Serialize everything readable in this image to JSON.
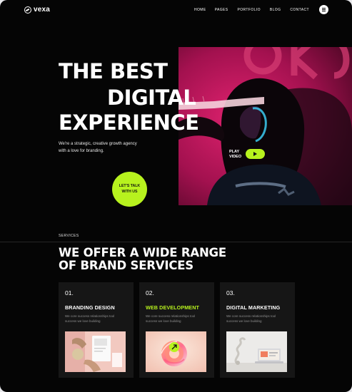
{
  "header": {
    "logo": "vexa",
    "nav": [
      "HOME",
      "PAGES",
      "PORTFOLIO",
      "BLOG",
      "CONTACT"
    ]
  },
  "hero": {
    "line1": "THE BEST",
    "line2": "DIGITAL",
    "line3": "EXPERIENCE",
    "subtitle": "We're a strategic, creative growth agency with a love for branding.",
    "cta": "LET'S TALK WITH US",
    "play_line1": "PLAY",
    "play_line2": "VIDEO"
  },
  "services": {
    "eyebrow": "SERVICES",
    "title_line1": "WE OFFER A WIDE RANGE",
    "title_line2": "OF BRAND SERVICES",
    "cards": [
      {
        "num": "01.",
        "title": "BRANDING DESIGN",
        "desc": "We core success relationships tool success we love building"
      },
      {
        "num": "02.",
        "title": "WEB DEVELOPMENT",
        "desc": "We core success relationships tool success we love building"
      },
      {
        "num": "03.",
        "title": "DIGITAL MARKETING",
        "desc": "We core success relationships tool success we love building"
      }
    ]
  },
  "colors": {
    "accent": "#b7f21e",
    "background": "#050505",
    "card": "#161616",
    "hero_magenta": "#c0185f"
  }
}
